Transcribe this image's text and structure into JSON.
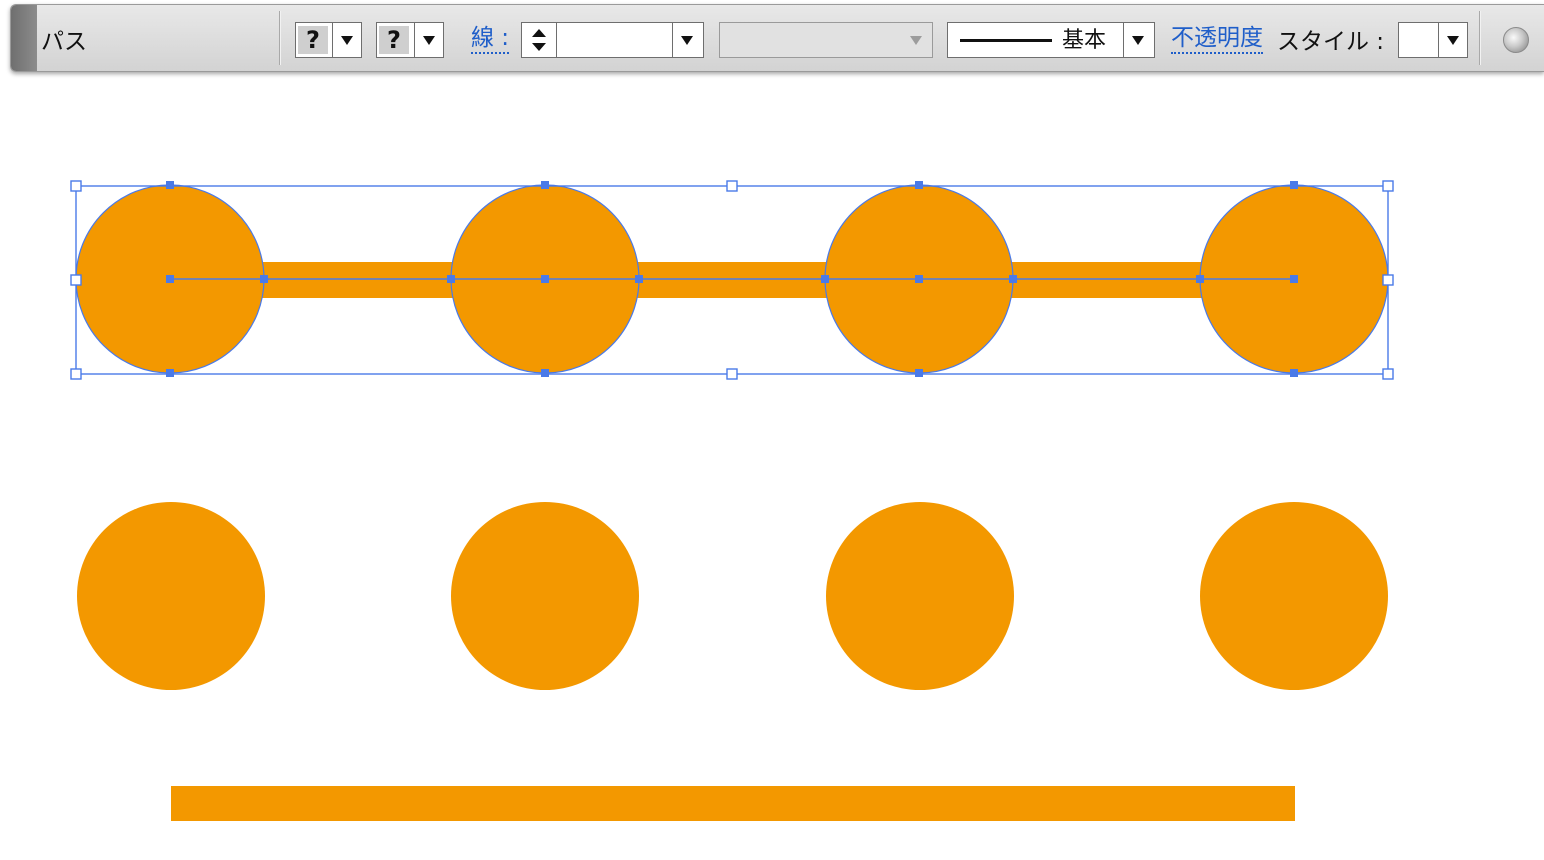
{
  "control_bar": {
    "selection_type": "パス",
    "fill_swatch": "?",
    "stroke_swatch": "?",
    "stroke_label": "線 :",
    "stroke_weight_value": "",
    "variable_width_value": "",
    "brush_profile_label": "基本",
    "opacity_label": "不透明度",
    "style_label": "スタイル :",
    "style_value": ""
  },
  "colors": {
    "shape_fill": "#f39800",
    "selection": "#4a7ae8"
  },
  "icons": {
    "globe": "recolor-globe-icon"
  },
  "artwork": {
    "groups": [
      {
        "name": "selected-group",
        "circles": 4,
        "connector_bar": true,
        "selected": true
      },
      {
        "name": "circles-row",
        "circles": 4,
        "connector_bar": false,
        "selected": false
      },
      {
        "name": "bar",
        "circles": 0,
        "connector_bar": true,
        "selected": false
      }
    ]
  }
}
